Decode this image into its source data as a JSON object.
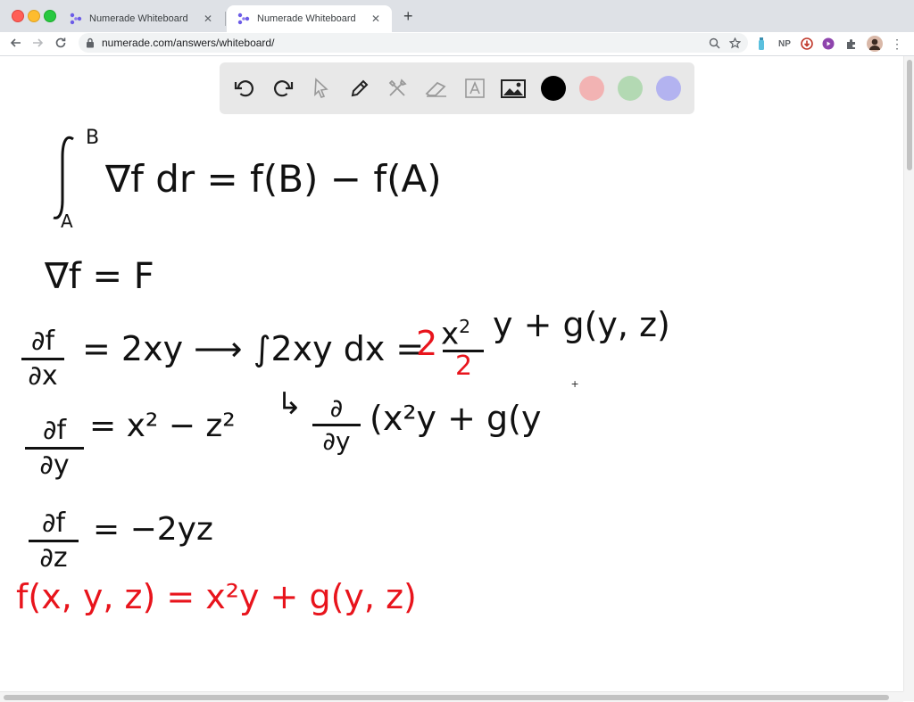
{
  "browser": {
    "tabs": [
      {
        "title": "Numerade Whiteboard",
        "active": false
      },
      {
        "title": "Numerade Whiteboard",
        "active": true
      }
    ],
    "url": "numerade.com/answers/whiteboard/",
    "extensions": [
      "NP"
    ],
    "colors": {
      "tab_strip": "#dee1e6",
      "favicon": "#6c5ce7"
    }
  },
  "whiteboard_toolbar": {
    "tools": [
      "undo-icon",
      "redo-icon",
      "select-icon",
      "pen-icon",
      "tools-icon",
      "eraser-icon",
      "text-icon",
      "image-icon"
    ],
    "swatches": [
      "#000000",
      "#f2b3b3",
      "#b3d9b3",
      "#b3b3f0"
    ]
  },
  "handwriting": {
    "line1_integrand": "∇f  dr = f(B) − f(A)",
    "line1_upper": "B",
    "line1_lower": "A",
    "line2": "∇f = F",
    "line3_num": "∂f",
    "line3_den": "∂x",
    "line3_rhs_pre": "= 2xy ⟶ ∫2xy dx = ",
    "line3_cancel2": "2",
    "line3_x": "x",
    "line3_sq": "2",
    "line3_den2": "2",
    "line3_rhs_post": "y + g(y, z)",
    "line4_num": "∂f",
    "line4_den": "∂y",
    "line4_rhs": "= x² − z²",
    "line4_arrow": "↳",
    "line4_dnum": "∂",
    "line4_dden": "∂y",
    "line4_expr": "(x²y + g(y",
    "line5_num": "∂f",
    "line5_den": "∂z",
    "line5_rhs": "= −2yz",
    "line6_red": "f(x, y, z) = x²y + g(y, z)"
  }
}
